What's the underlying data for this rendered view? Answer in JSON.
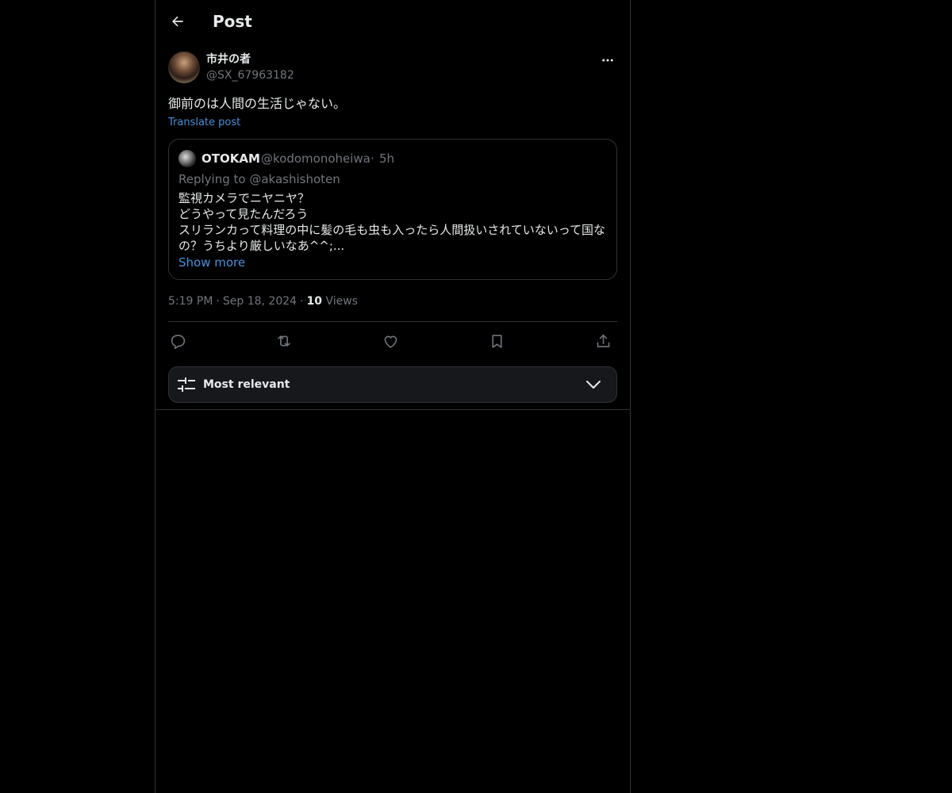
{
  "header": {
    "title": "Post",
    "back_icon": "arrow-left-icon"
  },
  "post": {
    "author": {
      "name": "市井の者",
      "handle": "@SX_67963182"
    },
    "text": "御前のは人間の生活じゃない。",
    "translate_label": "Translate post",
    "quote": {
      "name": "OTOKAM",
      "handle": "@kodomonoheiwa",
      "separator": "·",
      "time": "5h",
      "replying_to": "Replying to @akashishoten",
      "body": "監視カメラでニヤニヤ？\nどうやって見たんだろう\nスリランカって料理の中に髪の毛も虫も入ったら人間扱いされていないって国なの？うちより厳しいなあ^^;...",
      "show_more": "Show more"
    },
    "meta": {
      "time": "5:19 PM",
      "separator": "·",
      "date": "Sep 18, 2024",
      "views_count": "10",
      "views_label": "Views"
    },
    "actions": [
      "reply-icon",
      "repost-icon",
      "like-icon",
      "bookmark-icon",
      "share-icon"
    ]
  },
  "sort": {
    "label": "Most relevant"
  },
  "colors": {
    "background": "#000000",
    "text": "#e7e9ea",
    "muted": "#71767b",
    "link": "#4a90d9",
    "border": "#2f3336"
  }
}
